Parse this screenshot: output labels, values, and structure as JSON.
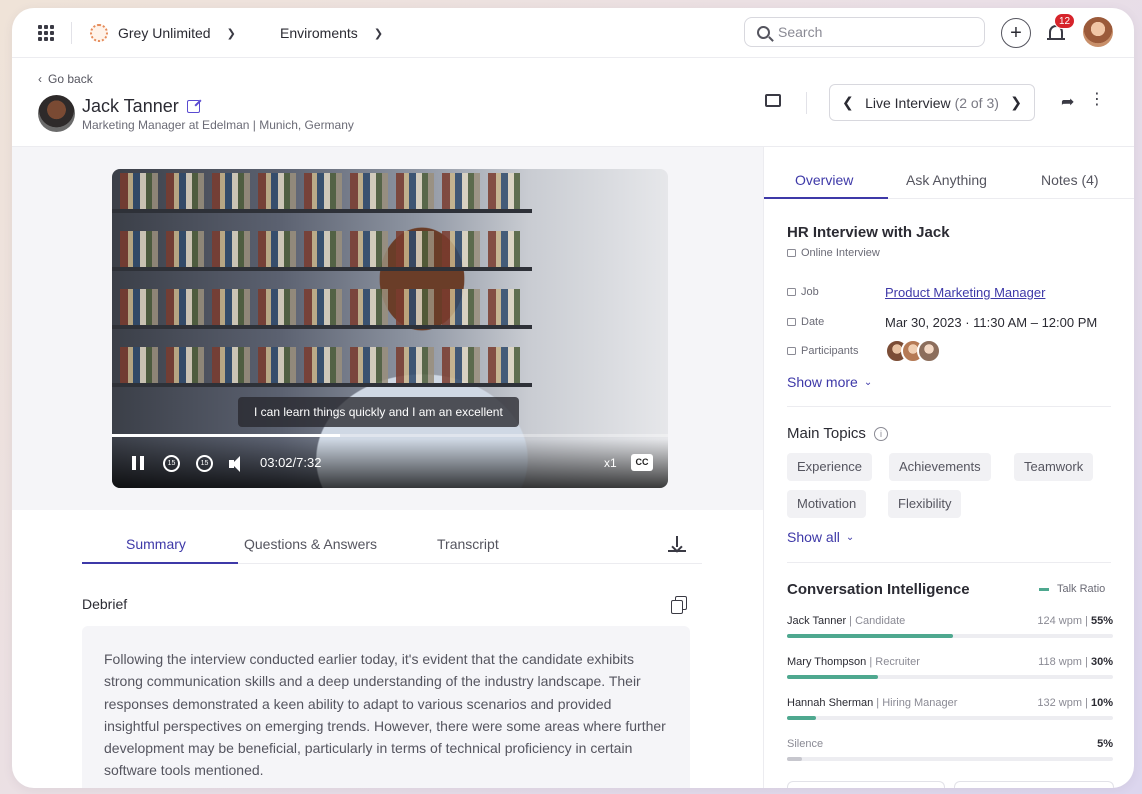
{
  "topbar": {
    "org_name": "Grey Unlimited",
    "environments_label": "Enviroments",
    "search_placeholder": "Search",
    "notification_count": "12",
    "icons": [
      "apps-grid-icon",
      "org-logo-icon",
      "search-icon",
      "plus-icon",
      "bell-icon",
      "user-avatar"
    ]
  },
  "header": {
    "go_back": "Go back",
    "candidate_name": "Jack Tanner",
    "candidate_role": "Marketing Manager at Edelman | Munich, Germany",
    "interview_nav_label": "Live Interview",
    "interview_nav_count": "(2 of 3)"
  },
  "video": {
    "caption": "I can learn things quickly and I am an excellent",
    "current_time": "03:02",
    "duration": "7:32",
    "time_display": "03:02/7:32",
    "progress": 0.41,
    "speed": "x1",
    "cc_label": "CC",
    "rewind_label": "15",
    "forward_label": "15"
  },
  "left_tabs": [
    {
      "label": "Summary",
      "active": true
    },
    {
      "label": "Questions & Answers",
      "active": false
    },
    {
      "label": "Transcript",
      "active": false
    }
  ],
  "debrief": {
    "title": "Debrief",
    "text": "Following the interview conducted earlier today, it's evident that the candidate exhibits strong communication skills and a deep understanding of the industry landscape. Their responses demonstrated a keen ability to adapt to various scenarios and provided insightful perspectives on emerging trends. However, there were some areas where further development may be beneficial, particularly in terms of technical proficiency in certain software tools mentioned."
  },
  "right_tabs": [
    {
      "label": "Overview",
      "active": true
    },
    {
      "label": "Ask Anything",
      "active": false
    },
    {
      "label": "Notes (4)",
      "active": false
    }
  ],
  "overview": {
    "title": "HR Interview with Jack",
    "type": "Online Interview",
    "job_label": "Job",
    "job_value": "Product Marketing Manager",
    "date_label": "Date",
    "date_value": "Mar 30, 2023 · 11:30 AM – 12:00 PM",
    "participants_label": "Participants",
    "show_more": "Show more"
  },
  "main_topics": {
    "title": "Main Topics",
    "chips": [
      "Experience",
      "Achievements",
      "Teamwork",
      "Motivation",
      "Flexibility"
    ],
    "show_all": "Show all"
  },
  "conversation_intelligence": {
    "title": "Conversation Intelligence",
    "legend": "Talk Ratio",
    "accent_color": "#4ea88f",
    "rows": [
      {
        "name": "Jack Tanner",
        "role": "Candidate",
        "wpm": "124 wpm",
        "pct": "55%",
        "ratio": 0.51
      },
      {
        "name": "Mary Thompson",
        "role": "Recruiter",
        "wpm": "118 wpm",
        "pct": "30%",
        "ratio": 0.28
      },
      {
        "name": "Hannah Sherman",
        "role": "Hiring Manager",
        "wpm": "132 wpm",
        "pct": "10%",
        "ratio": 0.09
      },
      {
        "name": "Silence",
        "role": "",
        "wpm": "",
        "pct": "5%",
        "ratio": 0.045
      }
    ]
  },
  "colors": {
    "accent": "#3e39a8",
    "link": "#3e39a8",
    "badge": "#d6242b"
  }
}
